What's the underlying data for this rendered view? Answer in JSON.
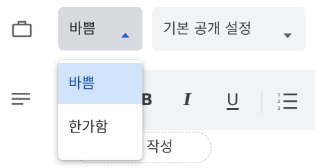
{
  "status": {
    "selected": "바쁨",
    "icon": "briefcase-icon",
    "options": [
      "바쁨",
      "한가함"
    ],
    "accent_color": "#1a5fd0",
    "selected_bg": "#d2e3fc"
  },
  "visibility": {
    "selected": "기본 공개 설정",
    "icon": "chevron-down-icon"
  },
  "description": {
    "icon": "notes-icon",
    "toolbar": {
      "bold": "B",
      "italic": "I",
      "underline": "U",
      "list_icon": "numbered-list-icon"
    },
    "add_button_visible_text": "록 작성"
  }
}
